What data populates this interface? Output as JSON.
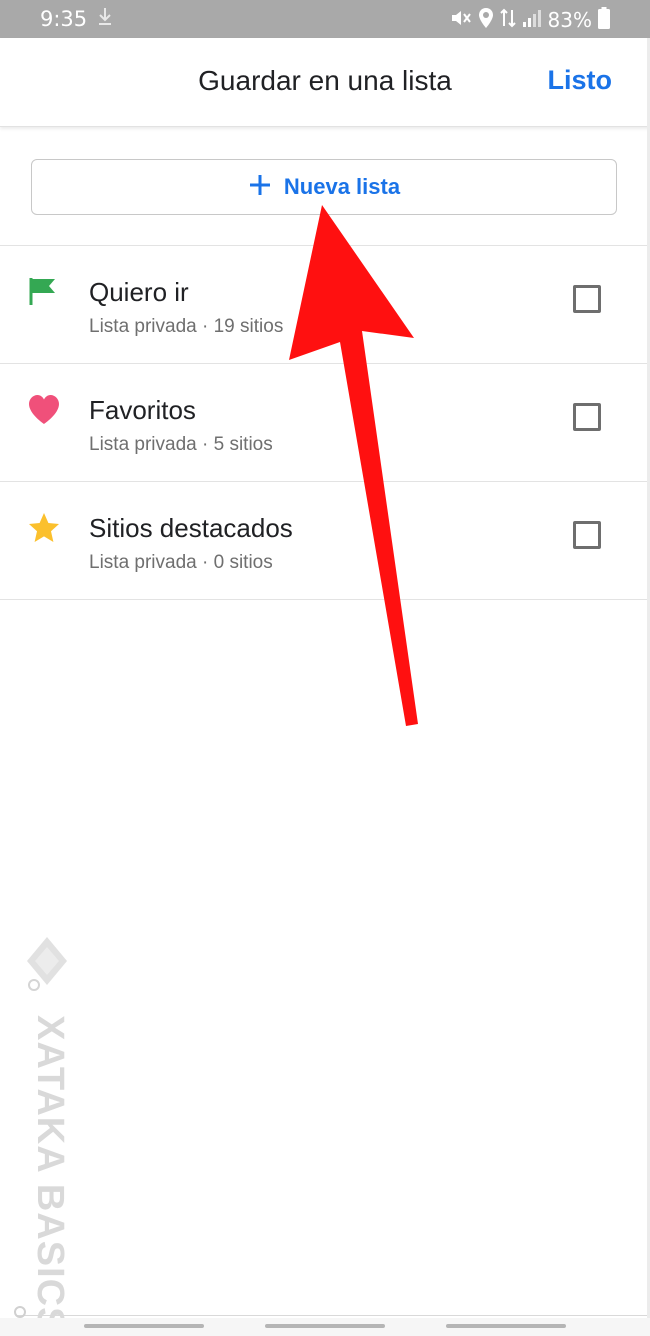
{
  "status_bar": {
    "time": "9:35",
    "battery": "83%",
    "icons": [
      "download-icon",
      "mute-icon",
      "location-icon",
      "data-icon",
      "signal-icon",
      "battery-icon"
    ]
  },
  "header": {
    "title": "Guardar en una lista",
    "done_label": "Listo"
  },
  "new_list": {
    "icon": "plus-icon",
    "label": "Nueva lista"
  },
  "lists": [
    {
      "title": "Quiero ir",
      "subtitle": "Lista privada · 19 sitios",
      "icon": "flag-icon",
      "color": "#34a853",
      "checked": false
    },
    {
      "title": "Favoritos",
      "subtitle": "Lista privada · 5 sitios",
      "icon": "heart-icon",
      "color": "#f0507a",
      "checked": false
    },
    {
      "title": "Sitios destacados",
      "subtitle": "Lista privada · 0 sitios",
      "icon": "star-icon",
      "color": "#fbc02d",
      "checked": false
    }
  ],
  "colors": {
    "accent": "#1a73e8",
    "annotation_arrow": "#ff1010"
  },
  "watermark": {
    "text": "XATAKA BASICS"
  }
}
